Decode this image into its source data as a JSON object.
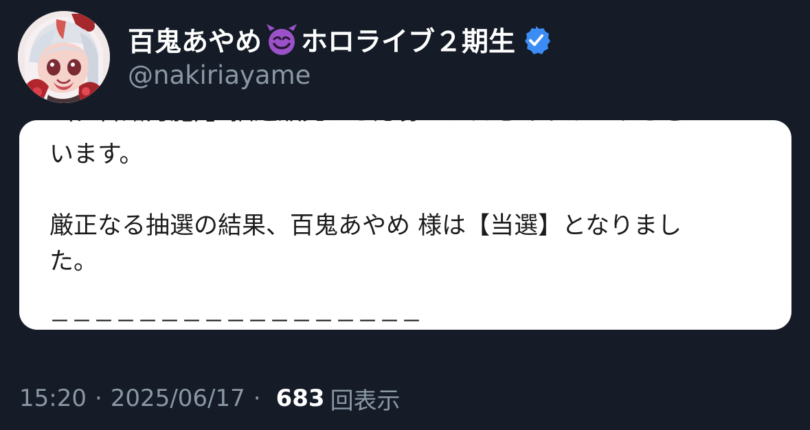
{
  "tweet": {
    "author": {
      "display_name_prefix": "百鬼あやめ",
      "display_name_suffix": "ホロライブ２期生",
      "emoji_icon": "smiling-devil-emoji",
      "handle": "@nakiriayame",
      "verified_icon": "verified-badge-icon",
      "verified_color": "#3b8df5"
    },
    "card": {
      "partial_top_line": "（ダ合館力施）」抽選販売にご応募いただきありがとうござい",
      "line1": "います。",
      "line2": "厳正なる抽選の結果、百鬼あやめ 様は【当選】となりまし",
      "line3": "た。",
      "line4": "－－－－－－－－－－－－－－－－－"
    },
    "meta": {
      "time": "15:20",
      "separator1": "·",
      "date": "2025/06/17",
      "separator2": "·",
      "views_count": "683",
      "views_label": "回表示"
    }
  }
}
